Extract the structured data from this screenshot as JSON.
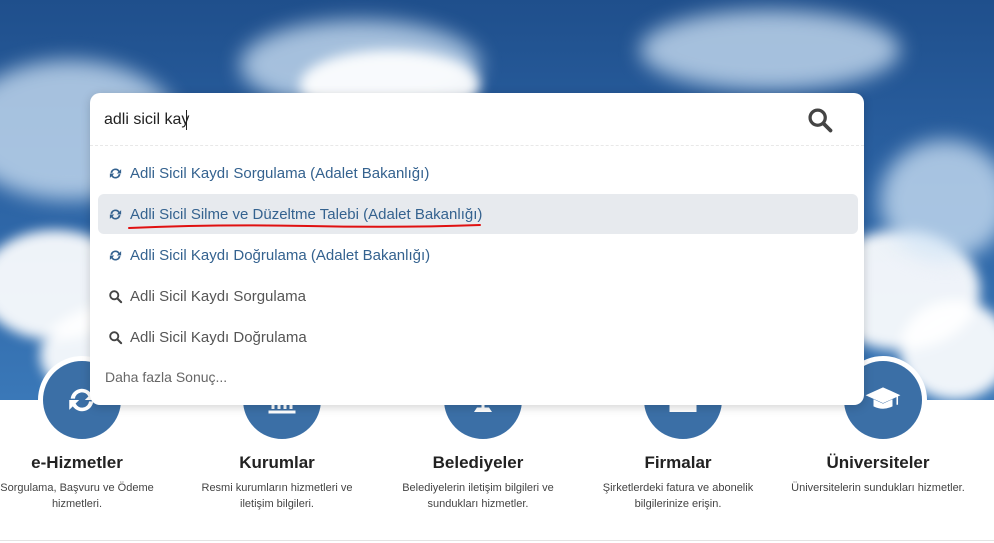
{
  "search": {
    "value": "adli sicil kay"
  },
  "suggestions": [
    {
      "label": "Adli Sicil Kaydı Sorgulama (Adalet Bakanlığı)",
      "icon": "refresh-icon"
    },
    {
      "label": "Adli Sicil Silme ve Düzeltme Talebi (Adalet Bakanlığı)",
      "icon": "refresh-icon"
    },
    {
      "label": "Adli Sicil Kaydı Doğrulama (Adalet Bakanlığı)",
      "icon": "refresh-icon"
    },
    {
      "label": "Adli Sicil Kaydı Sorgulama",
      "icon": "search-icon"
    },
    {
      "label": "Adli Sicil Kaydı Doğrulama",
      "icon": "search-icon"
    }
  ],
  "more_results": "Daha fazla Sonuç...",
  "categories": [
    {
      "title": "e-Hizmetler",
      "desc": "Sorgulama, Başvuru ve Ödeme hizmetleri.",
      "icon": "refresh-icon"
    },
    {
      "title": "Kurumlar",
      "desc": "Resmi kurumların hizmetleri ve iletişim bilgileri.",
      "icon": "building-icon"
    },
    {
      "title": "Belediyeler",
      "desc": "Belediyelerin iletişim bilgileri ve sundukları hizmetler.",
      "icon": "municipality-icon"
    },
    {
      "title": "Firmalar",
      "desc": "Şirketlerdeki fatura ve abonelik bilgilerinize erişin.",
      "icon": "factory-icon"
    },
    {
      "title": "Üniversiteler",
      "desc": "Üniversitelerin sundukları hizmetler.",
      "icon": "graduation-cap-icon"
    }
  ],
  "colors": {
    "accent": "#3b6fa6",
    "link": "#34628f",
    "highlight_row": "#e7eaee",
    "annotation": "#e01010"
  }
}
